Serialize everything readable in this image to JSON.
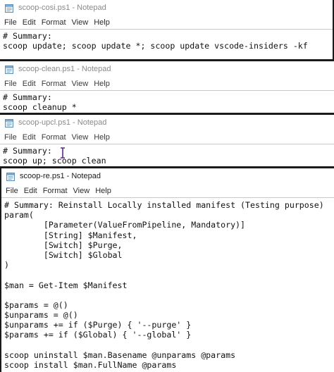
{
  "menu": [
    "File",
    "Edit",
    "Format",
    "View",
    "Help"
  ],
  "windows": [
    {
      "title": "scoop-cosi.ps1 - Notepad",
      "lines": [
        "# Summary:",
        "scoop update; scoop update *; scoop update vscode-insiders -kf"
      ]
    },
    {
      "title": "scoop-clean.ps1 - Notepad",
      "lines": [
        "# Summary:",
        "scoop cleanup *"
      ]
    },
    {
      "title": "scoop-upcl.ps1 - Notepad",
      "lines": [
        "# Summary:",
        "scoop up; scoop clean"
      ]
    },
    {
      "title": "scoop-re.ps1 - Notepad",
      "lines": [
        "# Summary: Reinstall Locally installed manifest (Testing purpose)",
        "param(",
        "        [Parameter(ValueFromPipeline, Mandatory)]",
        "        [String] $Manifest,",
        "        [Switch] $Purge,",
        "        [Switch] $Global",
        ")",
        "",
        "$man = Get-Item $Manifest",
        "",
        "$params = @()",
        "$unparams = @()",
        "$unparams += if ($Purge) { '--purge' }",
        "$params += if ($Global) { '--global' }",
        "",
        "scoop uninstall $man.Basename @unparams @params",
        "scoop install $man.FullName @params"
      ]
    }
  ],
  "colors": {
    "inactive_title": "#8a8a8a",
    "active_title": "#1a1a1a",
    "window_border": "#1a1a1a",
    "cursor": "#5a2a8a"
  },
  "icons": [
    "notepad-icon",
    "text-cursor-icon"
  ]
}
